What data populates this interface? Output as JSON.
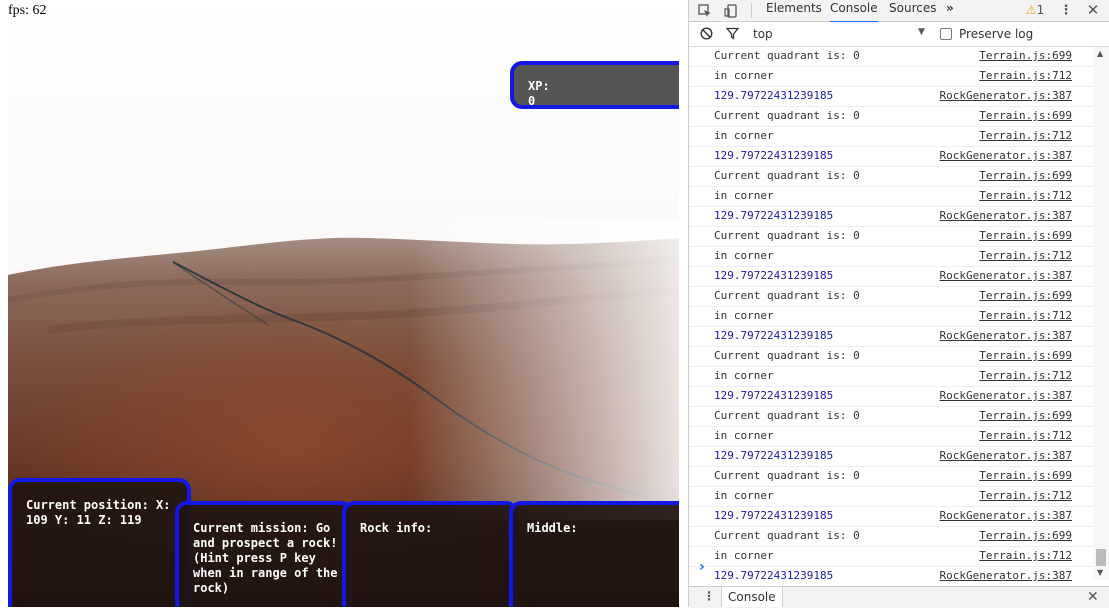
{
  "game": {
    "fps_label": "fps: 62",
    "xp": {
      "label": "XP:",
      "value": "0"
    },
    "position_panel": "Current position: X: 109 Y: 11 Z: 119",
    "mission_panel": "Current mission: Go and prospect a rock! (Hint press P key when in range of the rock)",
    "rock_info_panel": "Rock info:",
    "middle_panel": "Middle:"
  },
  "devtools": {
    "tabs": [
      "Elements",
      "Console",
      "Sources"
    ],
    "active_tab": "Console",
    "more_tabs_icon": "»",
    "warning_count": "1",
    "context": "top",
    "preserve_log_label": "Preserve log",
    "prompt_symbol": "›",
    "drawer_tab": "Console",
    "log": [
      {
        "text": "Current quadrant is: 0",
        "source": "Terrain.js:699",
        "kind": "log"
      },
      {
        "text": "in corner",
        "source": "Terrain.js:712",
        "kind": "log"
      },
      {
        "text": "129.79722431239185",
        "source": "RockGenerator.js:387",
        "kind": "number"
      },
      {
        "text": "Current quadrant is: 0",
        "source": "Terrain.js:699",
        "kind": "log"
      },
      {
        "text": "in corner",
        "source": "Terrain.js:712",
        "kind": "log"
      },
      {
        "text": "129.79722431239185",
        "source": "RockGenerator.js:387",
        "kind": "number"
      },
      {
        "text": "Current quadrant is: 0",
        "source": "Terrain.js:699",
        "kind": "log"
      },
      {
        "text": "in corner",
        "source": "Terrain.js:712",
        "kind": "log"
      },
      {
        "text": "129.79722431239185",
        "source": "RockGenerator.js:387",
        "kind": "number"
      },
      {
        "text": "Current quadrant is: 0",
        "source": "Terrain.js:699",
        "kind": "log"
      },
      {
        "text": "in corner",
        "source": "Terrain.js:712",
        "kind": "log"
      },
      {
        "text": "129.79722431239185",
        "source": "RockGenerator.js:387",
        "kind": "number"
      },
      {
        "text": "Current quadrant is: 0",
        "source": "Terrain.js:699",
        "kind": "log"
      },
      {
        "text": "in corner",
        "source": "Terrain.js:712",
        "kind": "log"
      },
      {
        "text": "129.79722431239185",
        "source": "RockGenerator.js:387",
        "kind": "number"
      },
      {
        "text": "Current quadrant is: 0",
        "source": "Terrain.js:699",
        "kind": "log"
      },
      {
        "text": "in corner",
        "source": "Terrain.js:712",
        "kind": "log"
      },
      {
        "text": "129.79722431239185",
        "source": "RockGenerator.js:387",
        "kind": "number"
      },
      {
        "text": "Current quadrant is: 0",
        "source": "Terrain.js:699",
        "kind": "log"
      },
      {
        "text": "in corner",
        "source": "Terrain.js:712",
        "kind": "log"
      },
      {
        "text": "129.79722431239185",
        "source": "RockGenerator.js:387",
        "kind": "number"
      },
      {
        "text": "Current quadrant is: 0",
        "source": "Terrain.js:699",
        "kind": "log"
      },
      {
        "text": "in corner",
        "source": "Terrain.js:712",
        "kind": "log"
      },
      {
        "text": "129.79722431239185",
        "source": "RockGenerator.js:387",
        "kind": "number"
      },
      {
        "text": "Current quadrant is: 0",
        "source": "Terrain.js:699",
        "kind": "log"
      },
      {
        "text": "in corner",
        "source": "Terrain.js:712",
        "kind": "log"
      },
      {
        "text": "129.79722431239185",
        "source": "RockGenerator.js:387",
        "kind": "number"
      }
    ]
  }
}
